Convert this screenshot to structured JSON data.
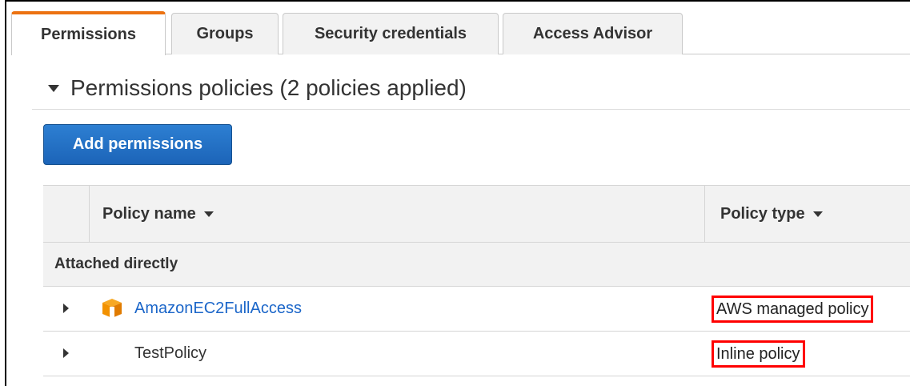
{
  "tabs": [
    {
      "label": "Permissions",
      "active": true
    },
    {
      "label": "Groups",
      "active": false
    },
    {
      "label": "Security credentials",
      "active": false
    },
    {
      "label": "Access Advisor",
      "active": false
    }
  ],
  "section": {
    "title": "Permissions policies (2 policies applied)"
  },
  "actions": {
    "add_label": "Add permissions"
  },
  "table": {
    "columns": [
      "Policy name",
      "Policy type"
    ],
    "group_label": "Attached directly",
    "rows": [
      {
        "name": "AmazonEC2FullAccess",
        "type": "AWS managed policy",
        "icon": "aws-managed-policy-icon"
      },
      {
        "name": "TestPolicy",
        "type": "Inline policy",
        "icon": ""
      }
    ]
  },
  "colors": {
    "accent": "#ec7211",
    "button": "#1c64b8",
    "link": "#1b66c9",
    "highlight": "#ff0000"
  }
}
